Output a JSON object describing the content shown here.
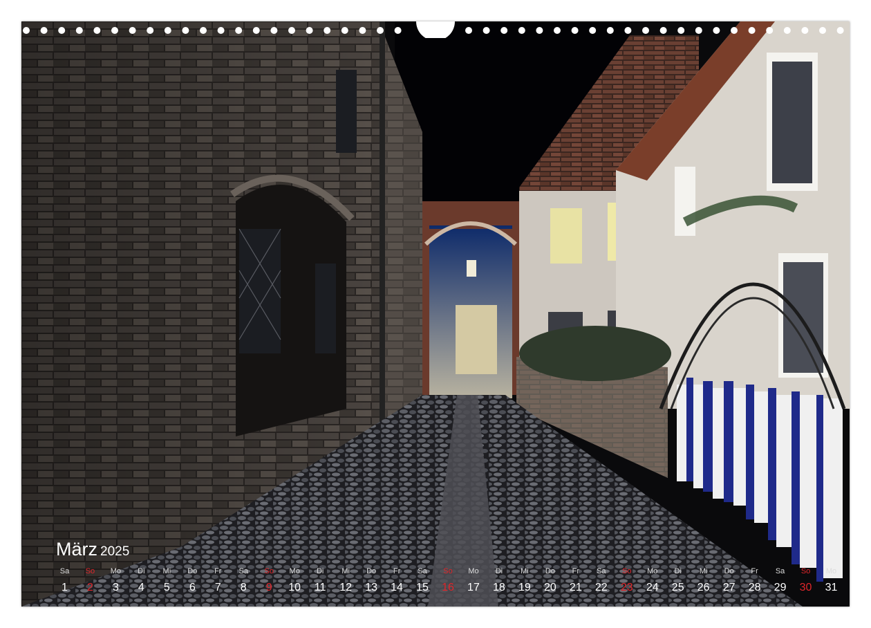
{
  "calendar": {
    "month": "März",
    "year": "2025",
    "days": [
      {
        "dow": "Sa",
        "day": "1"
      },
      {
        "dow": "So",
        "day": "2",
        "sunday": true
      },
      {
        "dow": "Mo",
        "day": "3"
      },
      {
        "dow": "Di",
        "day": "4"
      },
      {
        "dow": "Mi",
        "day": "5"
      },
      {
        "dow": "Do",
        "day": "6"
      },
      {
        "dow": "Fr",
        "day": "7"
      },
      {
        "dow": "Sa",
        "day": "8"
      },
      {
        "dow": "So",
        "day": "9",
        "sunday": true
      },
      {
        "dow": "Mo",
        "day": "10"
      },
      {
        "dow": "Di",
        "day": "11"
      },
      {
        "dow": "Mi",
        "day": "12"
      },
      {
        "dow": "Do",
        "day": "13"
      },
      {
        "dow": "Fr",
        "day": "14"
      },
      {
        "dow": "Sa",
        "day": "15"
      },
      {
        "dow": "So",
        "day": "16",
        "sunday": true
      },
      {
        "dow": "Mo",
        "day": "17"
      },
      {
        "dow": "Di",
        "day": "18"
      },
      {
        "dow": "Mi",
        "day": "19"
      },
      {
        "dow": "Do",
        "day": "20"
      },
      {
        "dow": "Fr",
        "day": "21"
      },
      {
        "dow": "Sa",
        "day": "22"
      },
      {
        "dow": "So",
        "day": "23",
        "sunday": true
      },
      {
        "dow": "Mo",
        "day": "24"
      },
      {
        "dow": "Di",
        "day": "25"
      },
      {
        "dow": "Mi",
        "day": "26"
      },
      {
        "dow": "Do",
        "day": "27"
      },
      {
        "dow": "Fr",
        "day": "28"
      },
      {
        "dow": "Sa",
        "day": "29"
      },
      {
        "dow": "So",
        "day": "30",
        "sunday": true
      },
      {
        "dow": "Mo",
        "day": "31"
      }
    ]
  },
  "colors": {
    "sunday": "#e0262a",
    "weekday": "#ffffff",
    "dow_label": "#dcdcdc"
  }
}
